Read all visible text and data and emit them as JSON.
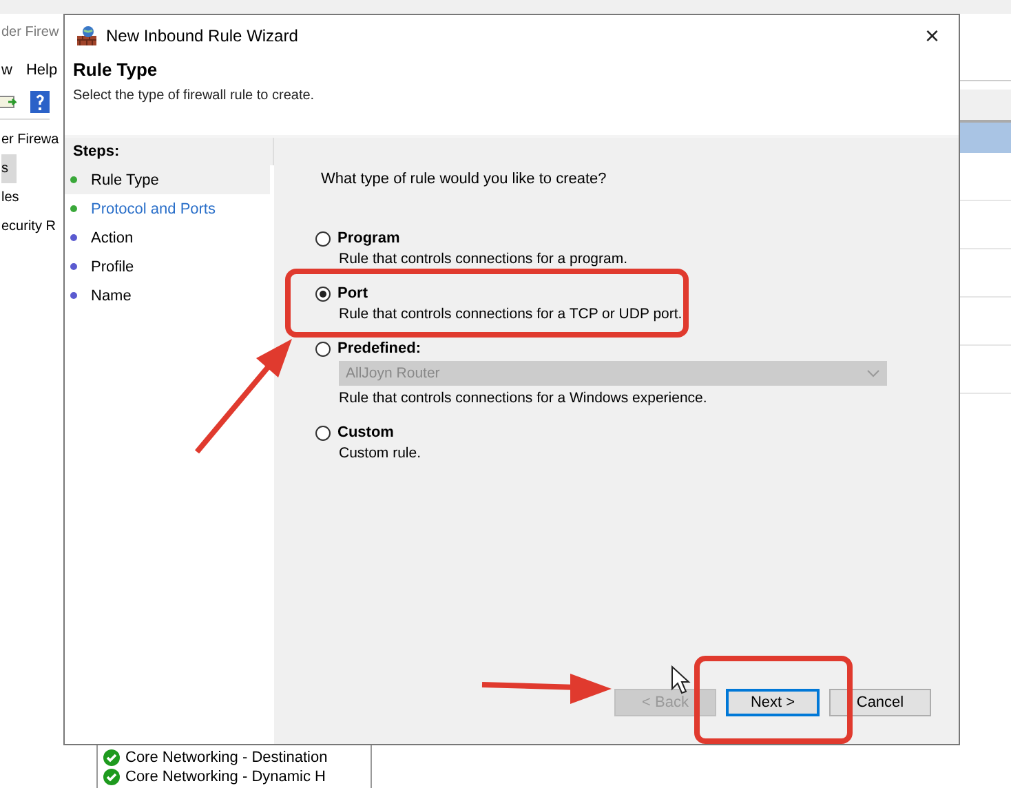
{
  "background": {
    "title": "der Firew",
    "menu": [
      "w",
      "Help"
    ],
    "tree": [
      {
        "label": "er Firewa",
        "selected": false
      },
      {
        "label": "s",
        "selected": true
      },
      {
        "label": "les",
        "selected": false
      },
      {
        "label": "ecurity R",
        "selected": false
      }
    ],
    "rules": [
      "Core Networking - Destination",
      "Core Networking - Dynamic H"
    ]
  },
  "window": {
    "title": "New Inbound Rule Wizard",
    "close": "×"
  },
  "header": {
    "title": "Rule Type",
    "subtitle": "Select the type of firewall rule to create."
  },
  "steps": {
    "heading": "Steps:",
    "items": [
      {
        "label": "Rule Type",
        "selected": true,
        "link": false,
        "color": "#3aa83a"
      },
      {
        "label": "Protocol and Ports",
        "selected": false,
        "link": true,
        "color": "#3aa83a"
      },
      {
        "label": "Action",
        "selected": false,
        "link": false,
        "color": "#5a5ad0"
      },
      {
        "label": "Profile",
        "selected": false,
        "link": false,
        "color": "#5a5ad0"
      },
      {
        "label": "Name",
        "selected": false,
        "link": false,
        "color": "#5a5ad0"
      }
    ]
  },
  "question": "What type of rule would you like to create?",
  "options": [
    {
      "kind": "plain",
      "label": "Program",
      "description": "Rule that controls connections for a program.",
      "selected": false
    },
    {
      "kind": "plain",
      "label": "Port",
      "description": "Rule that controls connections for a TCP or UDP port.",
      "selected": true
    },
    {
      "kind": "dropdown",
      "label": "Predefined:",
      "value": "AllJoyn Router",
      "disabled": true,
      "description": "Rule that controls connections for a Windows experience.",
      "selected": false
    },
    {
      "kind": "plain",
      "label": "Custom",
      "description": "Custom rule.",
      "selected": false
    }
  ],
  "buttons": [
    {
      "label": "< Back",
      "disabled": true,
      "default": false
    },
    {
      "label": "Next >",
      "disabled": false,
      "default": true
    },
    {
      "label": "Cancel",
      "disabled": false,
      "default": false
    }
  ]
}
